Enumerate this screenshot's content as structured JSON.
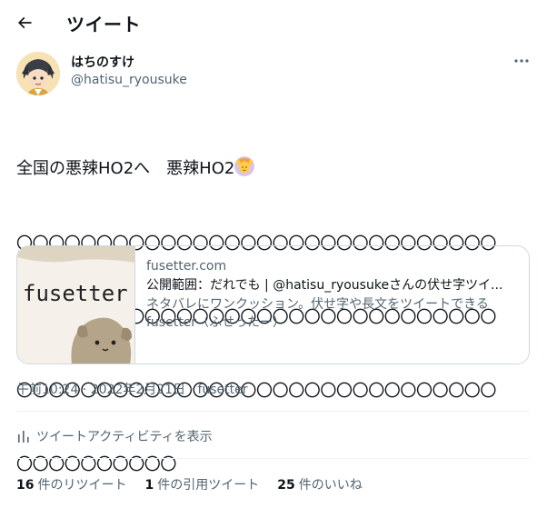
{
  "header": {
    "title": "ツイート"
  },
  "author": {
    "display_name": "はちのすけ",
    "handle": "@hatisu_ryousuke"
  },
  "tweet": {
    "line1": "全国の悪辣HO2へ　悪辣HO2",
    "emoji": "person-gesturing-ok",
    "circles": [
      "〇〇〇〇〇〇〇〇〇〇〇〇〇〇〇〇〇〇〇〇〇〇〇〇〇〇〇〇〇〇",
      "〇〇〇〇〇〇〇〇〇〇〇〇〇〇〇〇〇〇〇〇〇〇〇〇〇〇〇〇〇〇",
      "〇〇〇〇〇〇〇〇〇〇〇〇〇〇〇〇〇〇〇〇〇〇〇〇〇〇〇〇〇〇",
      "〇〇〇〇〇〇〇〇〇〇"
    ]
  },
  "card": {
    "thumb_text": "fusetter",
    "domain": "fusetter.com",
    "title": "公開範囲：だれでも | @hatisu_ryousukeさんの伏せ字ツイ...",
    "desc_line1": "ネタバレにワンクッション。伏せ字や長文をツイートできる",
    "desc_line2": "fusetter（ふせったー）"
  },
  "meta": {
    "time": "午前10:24",
    "sep1": " · ",
    "date": "2022年2月21日",
    "sep2": " · ",
    "source": "fusetter"
  },
  "activity": {
    "label": "ツイートアクティビティを表示"
  },
  "stats": {
    "retweets_count": "16",
    "retweets_label": "件のリツイート",
    "quotes_count": "1",
    "quotes_label": "件の引用ツイート",
    "likes_count": "25",
    "likes_label": "件のいいね"
  },
  "colors": {
    "text": "#0f1419",
    "secondary": "#536471",
    "border": "#cfd9de",
    "divider": "#eff3f4"
  }
}
